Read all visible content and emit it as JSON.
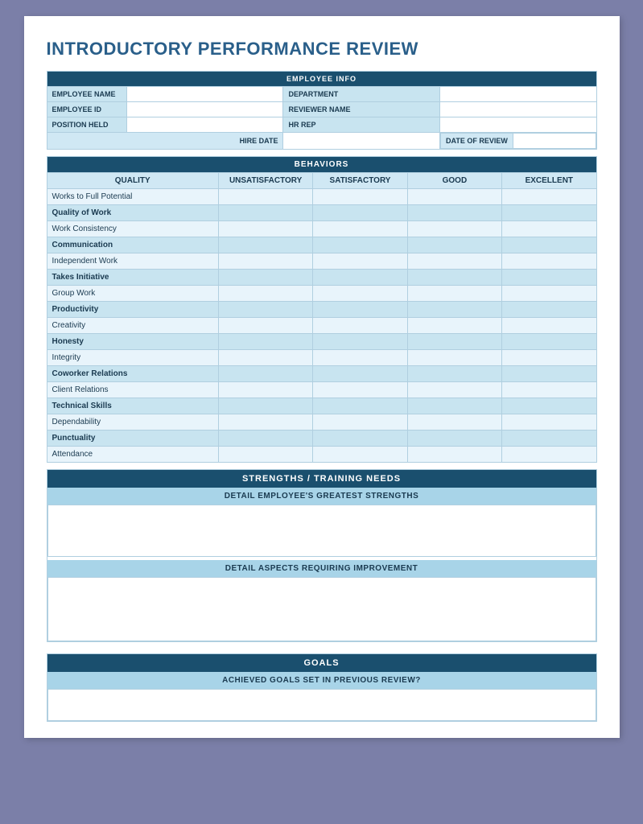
{
  "title": "INTRODUCTORY PERFORMANCE REVIEW",
  "employeeInfo": {
    "header": "EMPLOYEE INFO",
    "fields": [
      {
        "label": "EMPLOYEE NAME",
        "label2": "DEPARTMENT"
      },
      {
        "label": "EMPLOYEE ID",
        "label2": "REVIEWER NAME"
      },
      {
        "label": "POSITION HELD",
        "label2": "HR REP"
      },
      {
        "label": "HIRE DATE",
        "label2": "DATE OF REVIEW"
      }
    ]
  },
  "behaviors": {
    "header": "BEHAVIORS",
    "columns": [
      "QUALITY",
      "UNSATISFACTORY",
      "SATISFACTORY",
      "GOOD",
      "EXCELLENT"
    ],
    "rows": [
      {
        "label": "Works to Full Potential",
        "bold": false
      },
      {
        "label": "Quality of Work",
        "bold": true
      },
      {
        "label": "Work Consistency",
        "bold": false
      },
      {
        "label": "Communication",
        "bold": true
      },
      {
        "label": "Independent Work",
        "bold": false
      },
      {
        "label": "Takes Initiative",
        "bold": true
      },
      {
        "label": "Group Work",
        "bold": false
      },
      {
        "label": "Productivity",
        "bold": true
      },
      {
        "label": "Creativity",
        "bold": false
      },
      {
        "label": "Honesty",
        "bold": true
      },
      {
        "label": "Integrity",
        "bold": false
      },
      {
        "label": "Coworker Relations",
        "bold": true
      },
      {
        "label": "Client Relations",
        "bold": false
      },
      {
        "label": "Technical Skills",
        "bold": true
      },
      {
        "label": "Dependability",
        "bold": false
      },
      {
        "label": "Punctuality",
        "bold": true
      },
      {
        "label": "Attendance",
        "bold": false
      }
    ]
  },
  "strengths": {
    "header": "STRENGTHS / TRAINING NEEDS",
    "greatest_label": "DETAIL EMPLOYEE'S GREATEST STRENGTHS",
    "improvement_label": "DETAIL ASPECTS REQUIRING IMPROVEMENT"
  },
  "goals": {
    "header": "GOALS",
    "achieved_label": "ACHIEVED GOALS SET IN PREVIOUS REVIEW?"
  }
}
